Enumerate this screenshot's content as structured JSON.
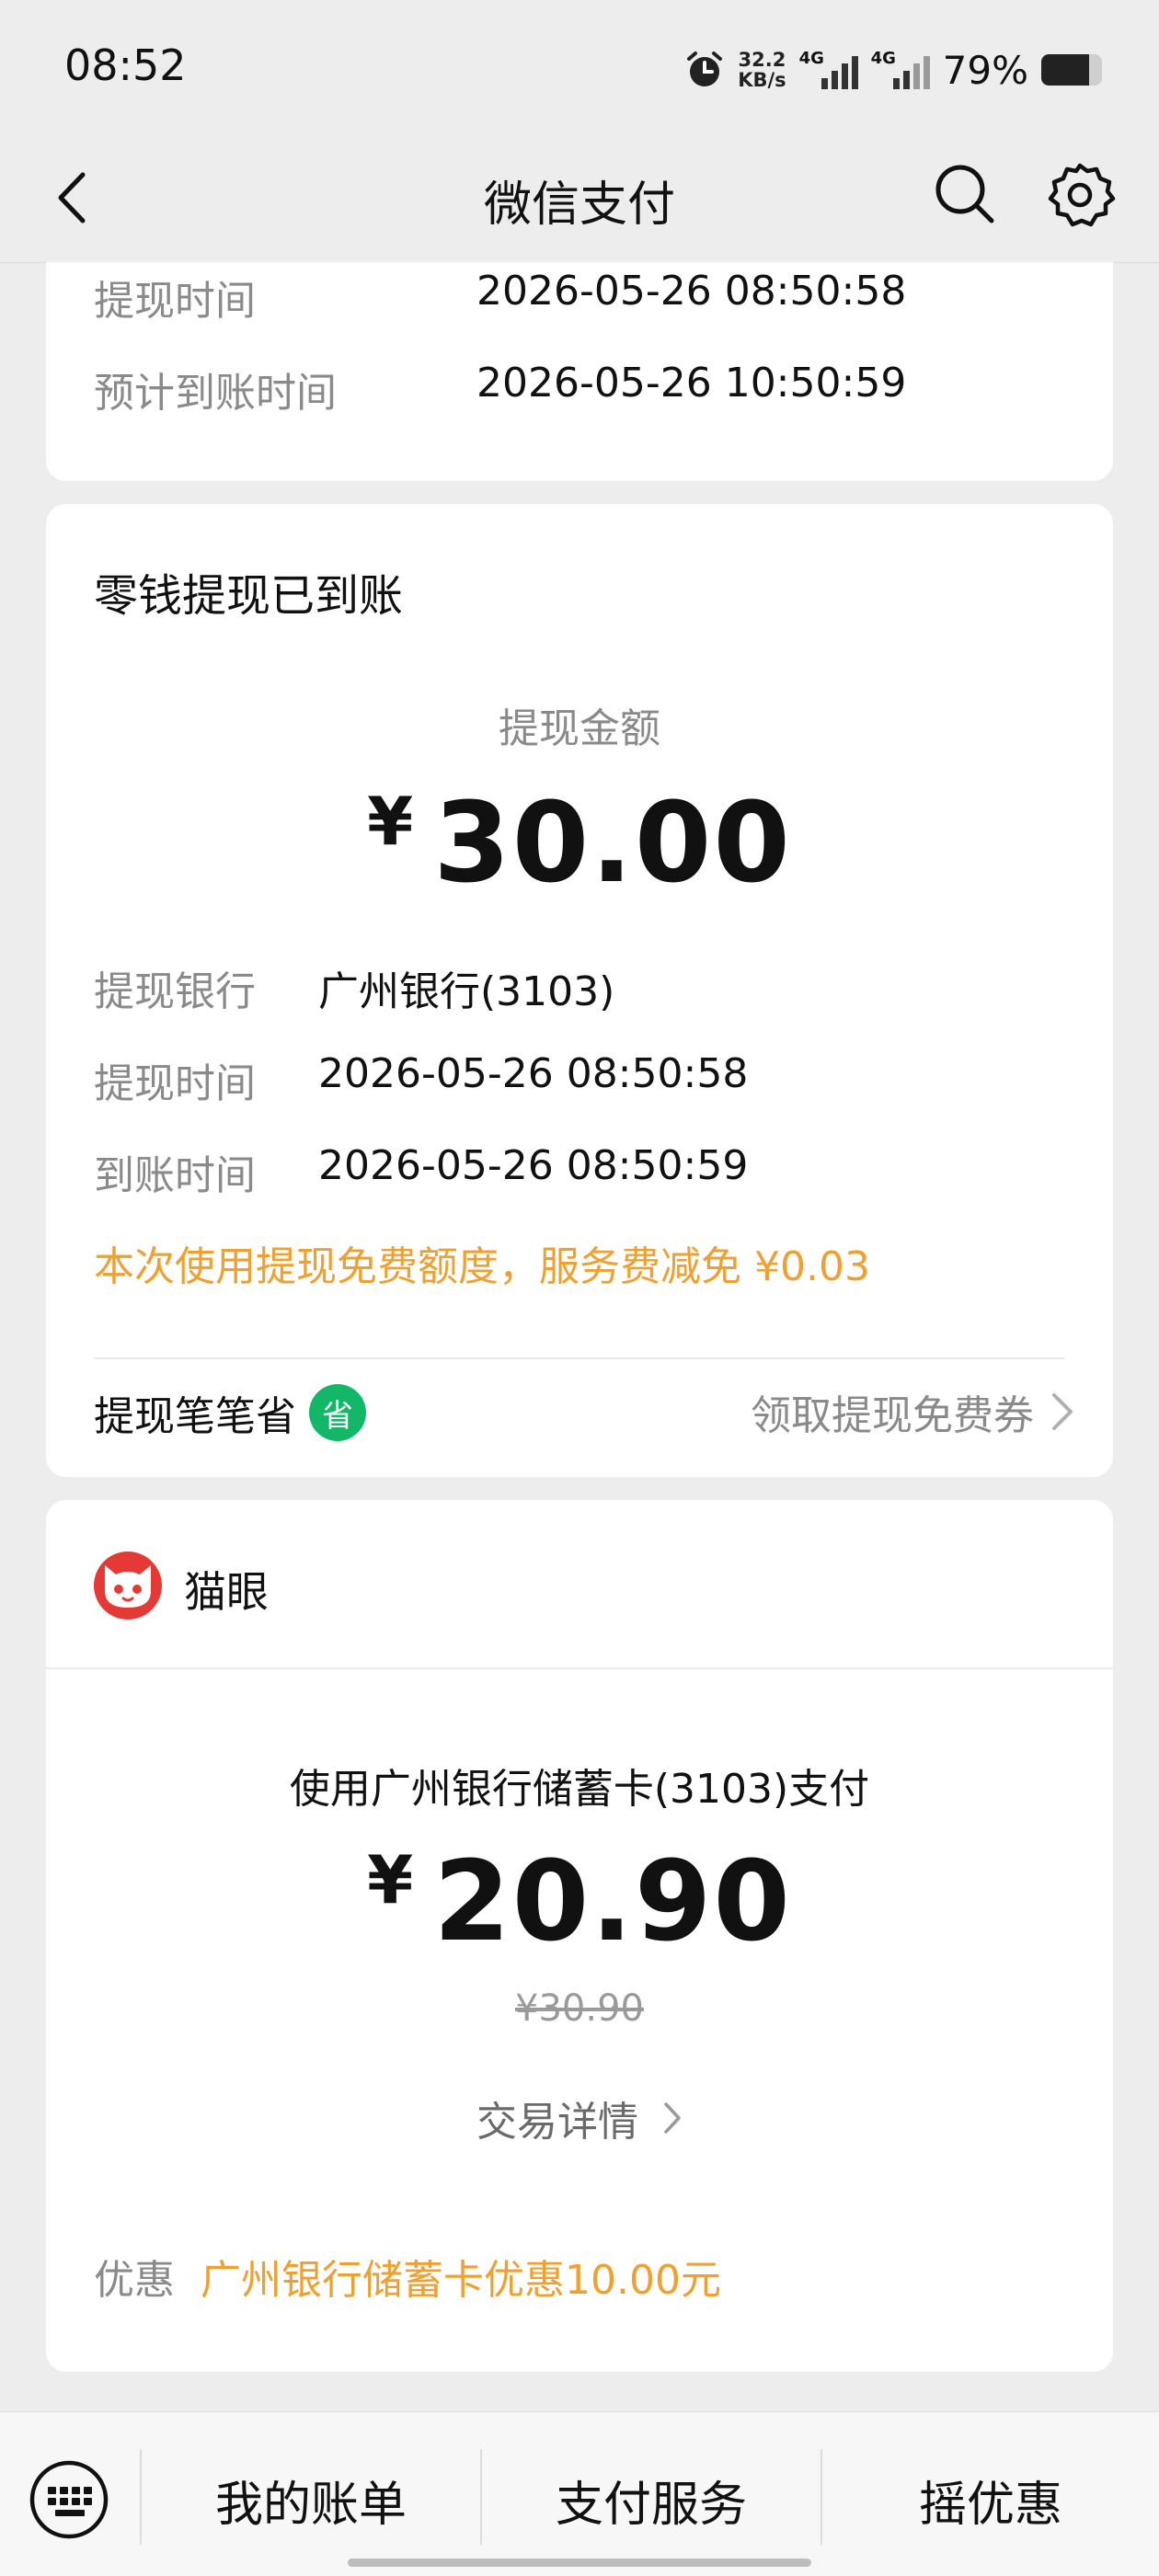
{
  "status_bar": {
    "time": "08:52",
    "net_speed_value": "32.2",
    "net_speed_unit": "KB/s",
    "sim1": "4G",
    "sim2": "4G",
    "battery_text": "79%",
    "battery_level": 0.79
  },
  "nav": {
    "title": "微信支付",
    "icons": [
      "back-chevron-icon",
      "search-icon",
      "gear-icon"
    ]
  },
  "top_card": {
    "rows": [
      {
        "label": "提现时间",
        "value": "2026-05-26 08:50:58"
      },
      {
        "label": "预计到账时间",
        "value": "2026-05-26 10:50:59"
      }
    ]
  },
  "withdraw_card": {
    "title": "零钱提现已到账",
    "amount_label": "提现金额",
    "currency": "¥",
    "amount": "30.00",
    "rows": [
      {
        "label": "提现银行",
        "value": "广州银行(3103)"
      },
      {
        "label": "提现时间",
        "value": "2026-05-26 08:50:58"
      },
      {
        "label": "到账时间",
        "value": "2026-05-26 08:50:59"
      }
    ],
    "notice": "本次使用提现免费额度，服务费减免 ¥0.03",
    "save_label": "提现笔笔省",
    "save_badge": "省",
    "coupon_link": "领取提现免费券"
  },
  "merchant_card": {
    "merchant_name": "猫眼",
    "pay_method": "使用广州银行储蓄卡(3103)支付",
    "currency": "¥",
    "amount": "20.90",
    "original_price": "¥30.90",
    "detail_link": "交易详情",
    "promo_label": "优惠",
    "promo_value": "广州银行储蓄卡优惠10.00元"
  },
  "bottom_bar": {
    "items": [
      "我的账单",
      "支付服务",
      "摇优惠"
    ]
  },
  "colors": {
    "accent_orange": "#f0a030",
    "green_badge": "#12b868",
    "merchant_red": "#e53935",
    "background": "#ededed"
  }
}
